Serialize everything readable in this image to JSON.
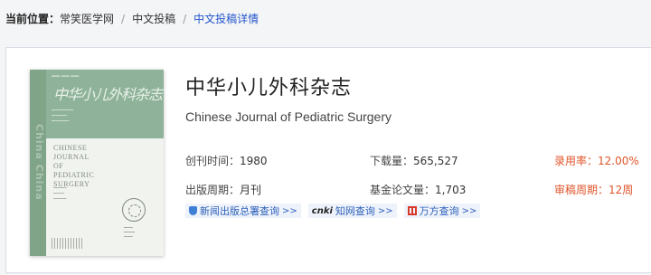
{
  "breadcrumb": {
    "label": "当前位置：",
    "items": [
      "常笑医学网",
      "中文投稿",
      "中文投稿详情"
    ],
    "separator": "/"
  },
  "journal": {
    "title_cn": "中华小儿外科杂志",
    "title_en": "Chinese Journal of Pediatric Surgery",
    "founded_label": "创刊时间：",
    "founded_value": "1980",
    "downloads_label": "下载量：",
    "downloads_value": "565,527",
    "acceptance_label": "录用率：",
    "acceptance_value": "12.00%",
    "period_label": "出版周期：",
    "period_value": "月刊",
    "funded_label": "基金论文量：",
    "funded_value": "1,703",
    "review_label": "审稿周期：",
    "review_value": "12周"
  },
  "cover": {
    "title_calligraphy": "中华小儿外科杂志",
    "title_en_lines": [
      "CHINESE",
      "JOURNAL",
      "OF",
      "PEDIATRIC",
      "SURGERY"
    ]
  },
  "links": [
    {
      "label": "新闻出版总署查询",
      "icon": "shield-icon",
      "arrows": ">>"
    },
    {
      "label": "知网查询",
      "icon": "cnki-icon",
      "arrows": ">>"
    },
    {
      "label": "万方查询",
      "icon": "wanfang-icon",
      "arrows": ">>"
    }
  ],
  "colors": {
    "accent": "#e0552a",
    "link": "#2c5fb8",
    "breadcrumb_current": "#2255cc"
  }
}
